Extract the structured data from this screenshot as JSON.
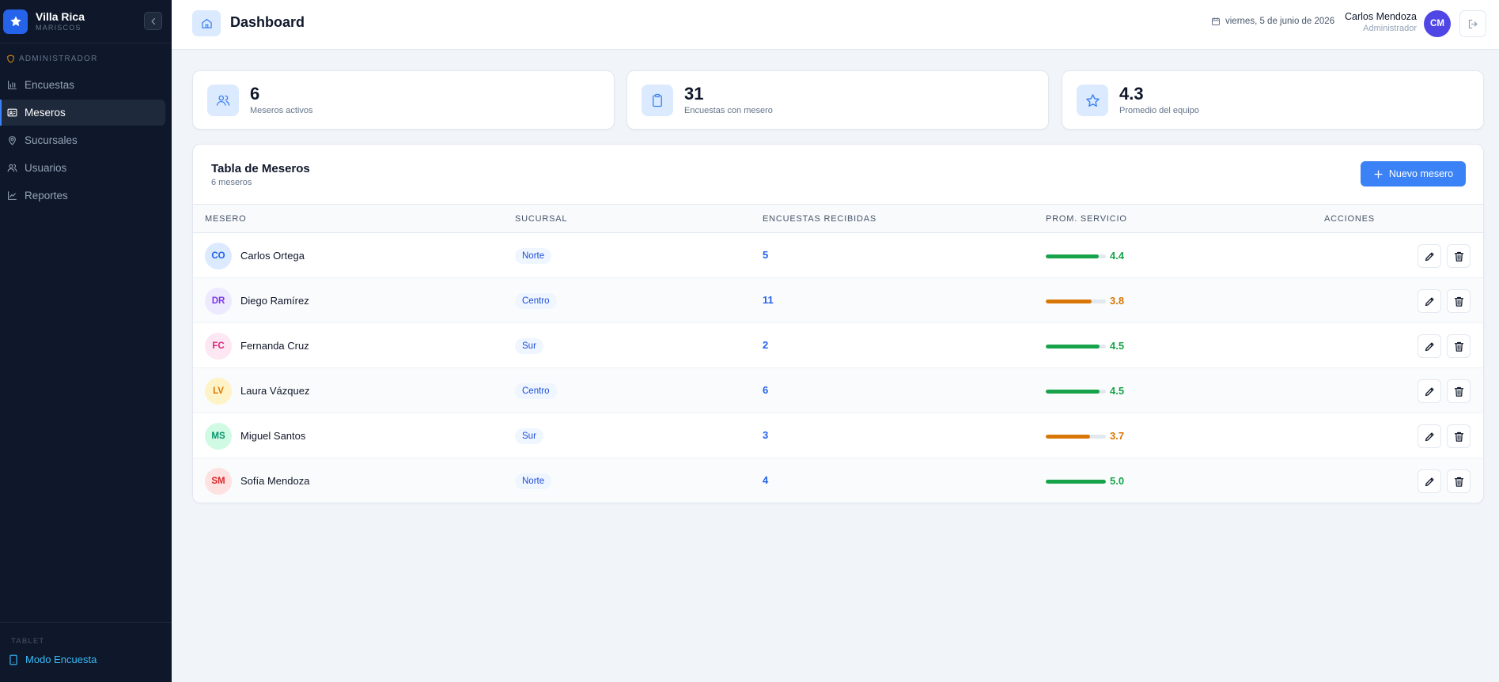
{
  "brand": {
    "name": "Villa Rica",
    "subtitle": "MARISCOS"
  },
  "sidebar": {
    "section_label": "ADMINISTRADOR",
    "items": [
      {
        "label": "Encuestas",
        "icon": "bar-chart-icon",
        "active": false
      },
      {
        "label": "Meseros",
        "icon": "id-card-icon",
        "active": true
      },
      {
        "label": "Sucursales",
        "icon": "map-pin-icon",
        "active": false
      },
      {
        "label": "Usuarios",
        "icon": "users-icon",
        "active": false
      },
      {
        "label": "Reportes",
        "icon": "trend-line-icon",
        "active": false
      }
    ],
    "bottom_label": "TABLET",
    "bottom_link": "Modo Encuesta"
  },
  "header": {
    "title": "Dashboard",
    "date": "viernes, 5 de junio de 2026",
    "user_name": "Carlos Mendoza",
    "user_role": "Administrador",
    "user_initials": "CM"
  },
  "stats": [
    {
      "value": "6",
      "label": "Meseros activos",
      "icon": "users-icon"
    },
    {
      "value": "31",
      "label": "Encuestas con mesero",
      "icon": "clipboard-icon"
    },
    {
      "value": "4.3",
      "label": "Promedio del equipo",
      "icon": "star-icon"
    }
  ],
  "table": {
    "title": "Tabla de Meseros",
    "subtitle": "6 meseros",
    "new_button": "Nuevo mesero",
    "columns": [
      "MESERO",
      "SUCURSAL",
      "ENCUESTAS RECIBIDAS",
      "PROM. SERVICIO",
      "ACCIONES"
    ],
    "rows": [
      {
        "initials": "CO",
        "name": "Carlos Ortega",
        "sucursal": "Norte",
        "encuestas": "5",
        "promedio": "4.4",
        "rating": 4.4,
        "avatar_bg": "#dbeafe",
        "avatar_fg": "#2563eb",
        "score_color": "#16a34a"
      },
      {
        "initials": "DR",
        "name": "Diego Ramírez",
        "sucursal": "Centro",
        "encuestas": "11",
        "promedio": "3.8",
        "rating": 3.8,
        "avatar_bg": "#ede9fe",
        "avatar_fg": "#7c3aed",
        "score_color": "#d97706"
      },
      {
        "initials": "FC",
        "name": "Fernanda Cruz",
        "sucursal": "Sur",
        "encuestas": "2",
        "promedio": "4.5",
        "rating": 4.5,
        "avatar_bg": "#fce7f3",
        "avatar_fg": "#db2777",
        "score_color": "#16a34a"
      },
      {
        "initials": "LV",
        "name": "Laura Vázquez",
        "sucursal": "Centro",
        "encuestas": "6",
        "promedio": "4.5",
        "rating": 4.5,
        "avatar_bg": "#fef3c7",
        "avatar_fg": "#d97706",
        "score_color": "#16a34a"
      },
      {
        "initials": "MS",
        "name": "Miguel Santos",
        "sucursal": "Sur",
        "encuestas": "3",
        "promedio": "3.7",
        "rating": 3.7,
        "avatar_bg": "#d1fae5",
        "avatar_fg": "#059669",
        "score_color": "#d97706"
      },
      {
        "initials": "SM",
        "name": "Sofía Mendoza",
        "sucursal": "Norte",
        "encuestas": "4",
        "promedio": "5.0",
        "rating": 5.0,
        "avatar_bg": "#fee2e2",
        "avatar_fg": "#dc2626",
        "score_color": "#16a34a"
      }
    ]
  }
}
